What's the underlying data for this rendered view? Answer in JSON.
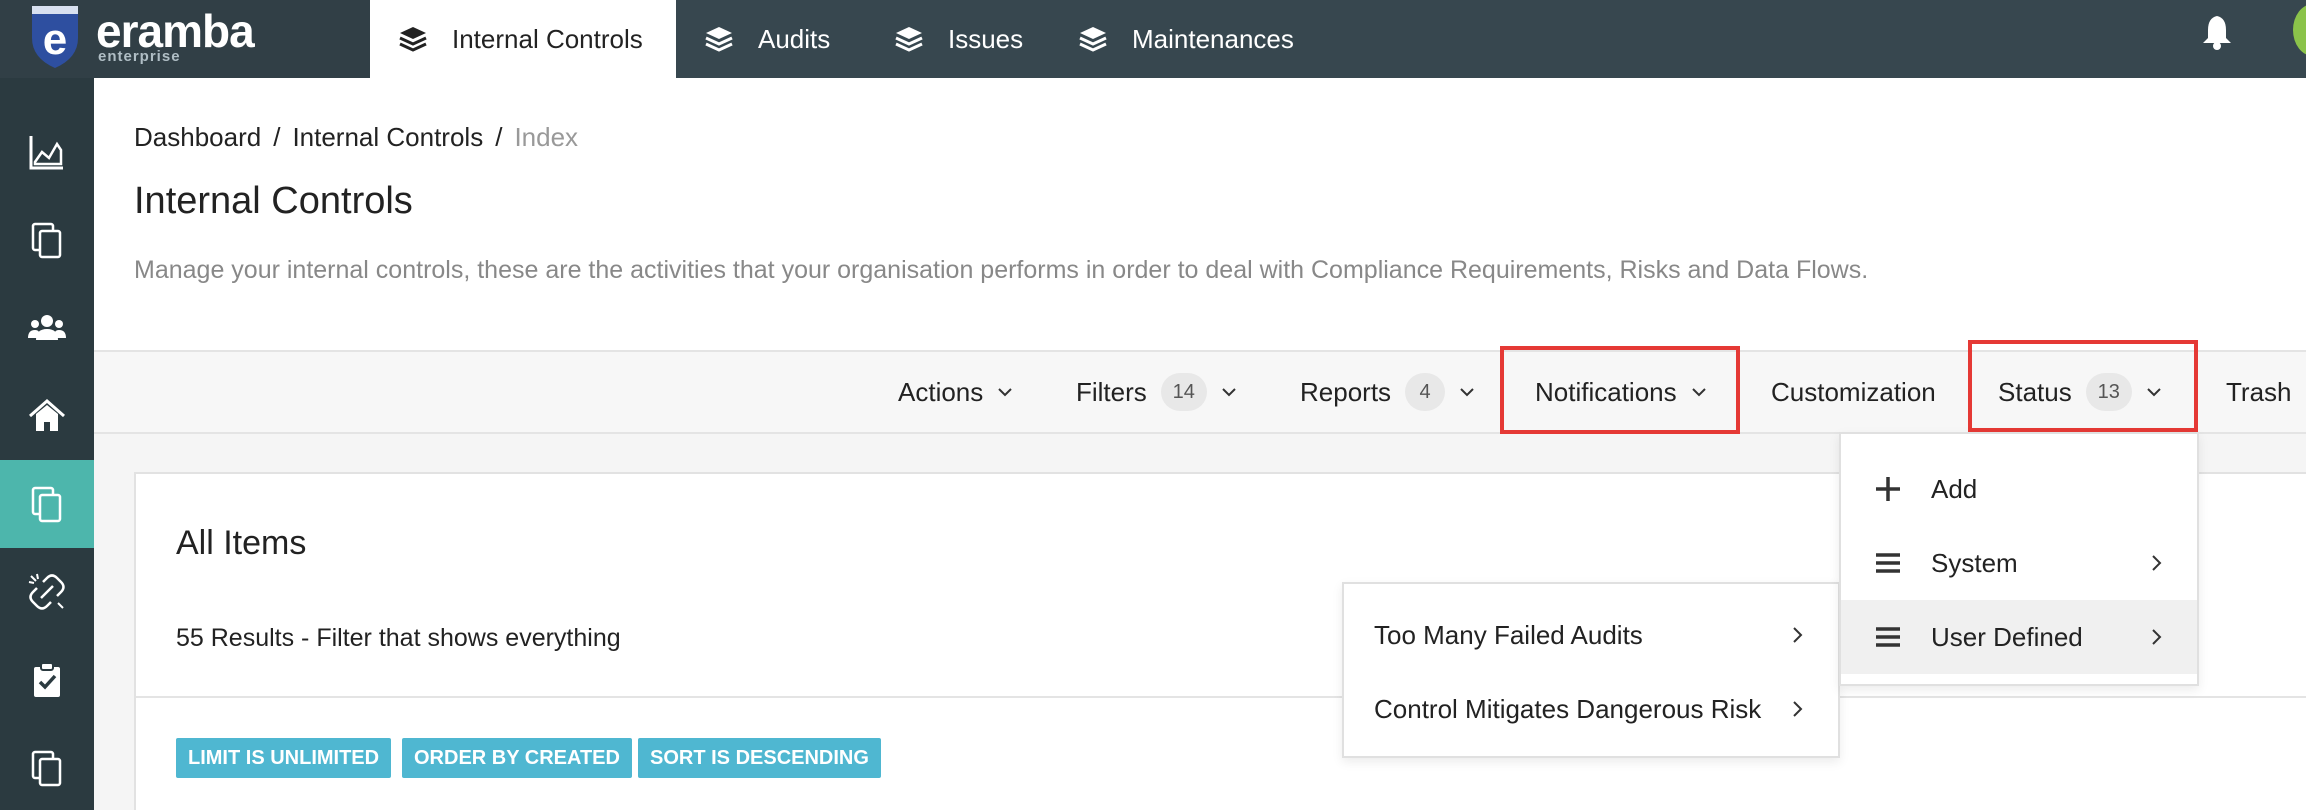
{
  "header": {
    "logo": {
      "name": "eramba",
      "sub": "enterprise"
    },
    "tabs": [
      {
        "label": "Internal Controls",
        "icon": "layers-icon",
        "active": true
      },
      {
        "label": "Audits",
        "icon": "layers-icon"
      },
      {
        "label": "Issues",
        "icon": "layers-icon"
      },
      {
        "label": "Maintenances",
        "icon": "layers-icon"
      }
    ]
  },
  "sidebar": {
    "items": [
      {
        "icon": "chart-area-icon"
      },
      {
        "icon": "copy-icon"
      },
      {
        "icon": "users-icon"
      },
      {
        "icon": "home-icon"
      },
      {
        "icon": "copy-icon",
        "active": true
      },
      {
        "icon": "unlink-icon"
      },
      {
        "icon": "clipboard-check-icon"
      },
      {
        "icon": "copy-icon"
      }
    ]
  },
  "breadcrumb": {
    "items": [
      "Dashboard",
      "Internal Controls"
    ],
    "current": "Index",
    "separator": "/"
  },
  "page": {
    "title": "Internal Controls",
    "description": "Manage your internal controls, these are the activities that your organisation performs in order to deal with Compliance Requirements, Risks and Data Flows."
  },
  "toolbar": {
    "actions": "Actions",
    "filters": "Filters",
    "filters_count": "14",
    "reports": "Reports",
    "reports_count": "4",
    "notifications": "Notifications",
    "customization": "Customization",
    "status": "Status",
    "status_count": "13",
    "trash": "Trash"
  },
  "card": {
    "title": "All Items",
    "results": "55 Results - Filter that shows everything",
    "tags": [
      "LIMIT IS UNLIMITED",
      "ORDER BY CREATED",
      "SORT IS DESCENDING"
    ]
  },
  "status_menu": {
    "items": [
      {
        "label": "Add",
        "icon": "plus-icon"
      },
      {
        "label": "System",
        "icon": "bars-icon",
        "submenu": true
      },
      {
        "label": "User Defined",
        "icon": "bars-icon",
        "submenu": true,
        "hover": true
      }
    ]
  },
  "submenu": {
    "items": [
      {
        "label": "Too Many Failed Audits"
      },
      {
        "label": "Control Mitigates Dangerous Risk"
      }
    ]
  },
  "colors": {
    "topbar": "#37474f",
    "sidebar": "#2b3a40",
    "sidebar_active": "#4db6ac",
    "highlight_box": "#e53935",
    "tag": "#4fb7d1"
  }
}
